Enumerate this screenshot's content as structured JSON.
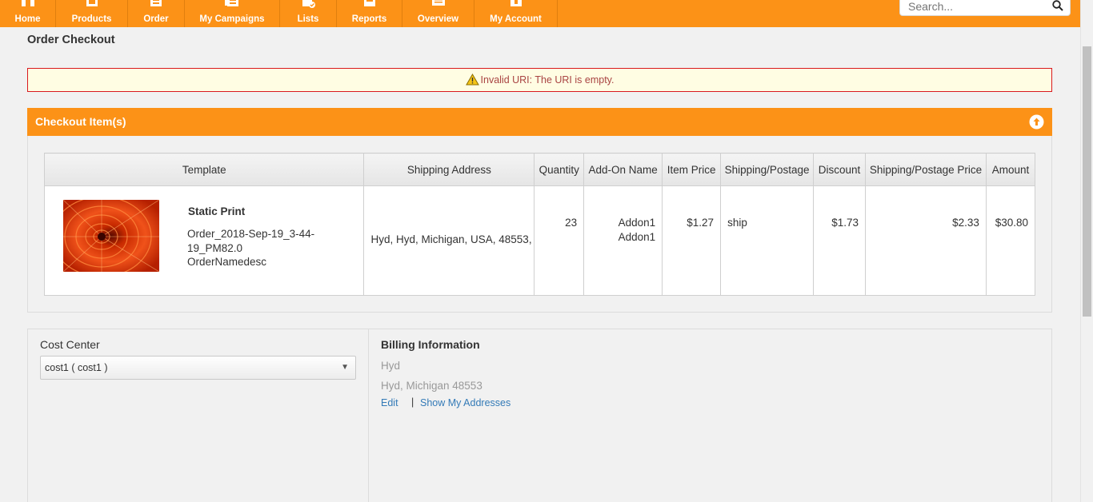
{
  "nav": {
    "items": [
      {
        "label": "Home",
        "icon": "home-icon"
      },
      {
        "label": "Products",
        "icon": "products-icon"
      },
      {
        "label": "Order",
        "icon": "order-icon"
      },
      {
        "label": "My Campaigns",
        "icon": "campaigns-icon"
      },
      {
        "label": "Lists",
        "icon": "lists-icon"
      },
      {
        "label": "Reports",
        "icon": "reports-icon"
      },
      {
        "label": "Overview",
        "icon": "overview-icon"
      },
      {
        "label": "My Account",
        "icon": "account-icon"
      }
    ],
    "search_placeholder": "Search..."
  },
  "colors": {
    "brand_orange": "#fc9217",
    "alert_border": "#d9181e",
    "alert_text": "#a94442",
    "link_blue": "#337ab7"
  },
  "page": {
    "title": "Order Checkout",
    "alert_message": "Invalid URI: The URI is empty."
  },
  "checkout": {
    "header": "Checkout Item(s)",
    "columns": [
      "Template",
      "Shipping Address",
      "Quantity",
      "Add-On Name",
      "Item Price",
      "Shipping/Postage",
      "Discount",
      "Shipping/Postage Price",
      "Amount"
    ],
    "rows": [
      {
        "template_name": "Static Print",
        "order_name": "Order_2018-Sep-19_3-44-19_PM82.0",
        "description": "OrderNamedesc",
        "shipping_address": "Hyd, Hyd, Michigan, USA, 48553,",
        "quantity": "23",
        "addons": [
          "Addon1",
          "Addon1"
        ],
        "item_price": "$1.27",
        "shipping_postage": "ship",
        "discount": "$1.73",
        "shipping_postage_price": "$2.33",
        "amount": "$30.80"
      }
    ]
  },
  "cost_center": {
    "label": "Cost Center",
    "selected": "cost1 ( cost1 )"
  },
  "billing": {
    "label": "Billing Information",
    "name": "Hyd",
    "city_line": "Hyd, Michigan 48553",
    "edit_label": "Edit",
    "separator": "|",
    "show_addresses_label": "Show My Addresses"
  }
}
